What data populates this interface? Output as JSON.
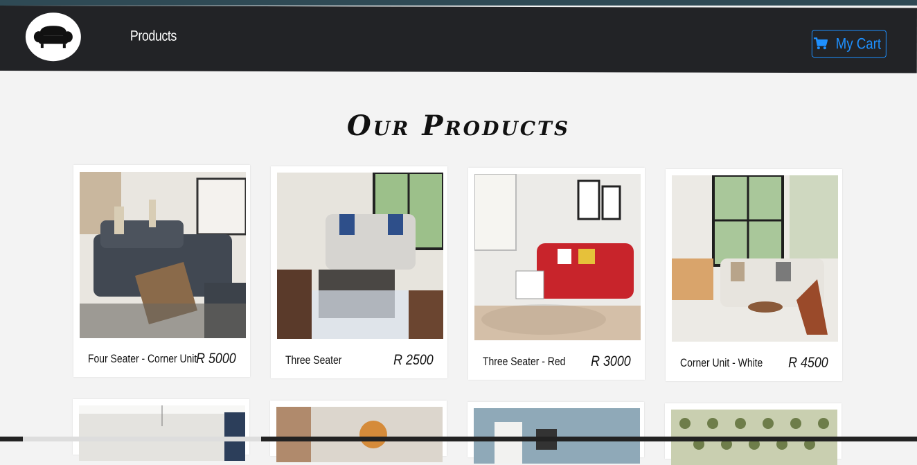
{
  "nav": {
    "products_label": "Products",
    "cart_label": "My Cart"
  },
  "heading": "Our Products",
  "products": [
    {
      "name": "Four Seater - Corner Unit",
      "price": "R 5000"
    },
    {
      "name": "Three Seater",
      "price": "R 2500"
    },
    {
      "name": "Three Seater - Red",
      "price": "R 3000"
    },
    {
      "name": "Corner Unit - White",
      "price": "R 4500"
    }
  ],
  "icons": {
    "logo": "sofa-icon",
    "cart": "cart-icon"
  },
  "colors": {
    "navbar": "#222326",
    "accent": "#1e90ff",
    "background": "#f3f3f3"
  }
}
